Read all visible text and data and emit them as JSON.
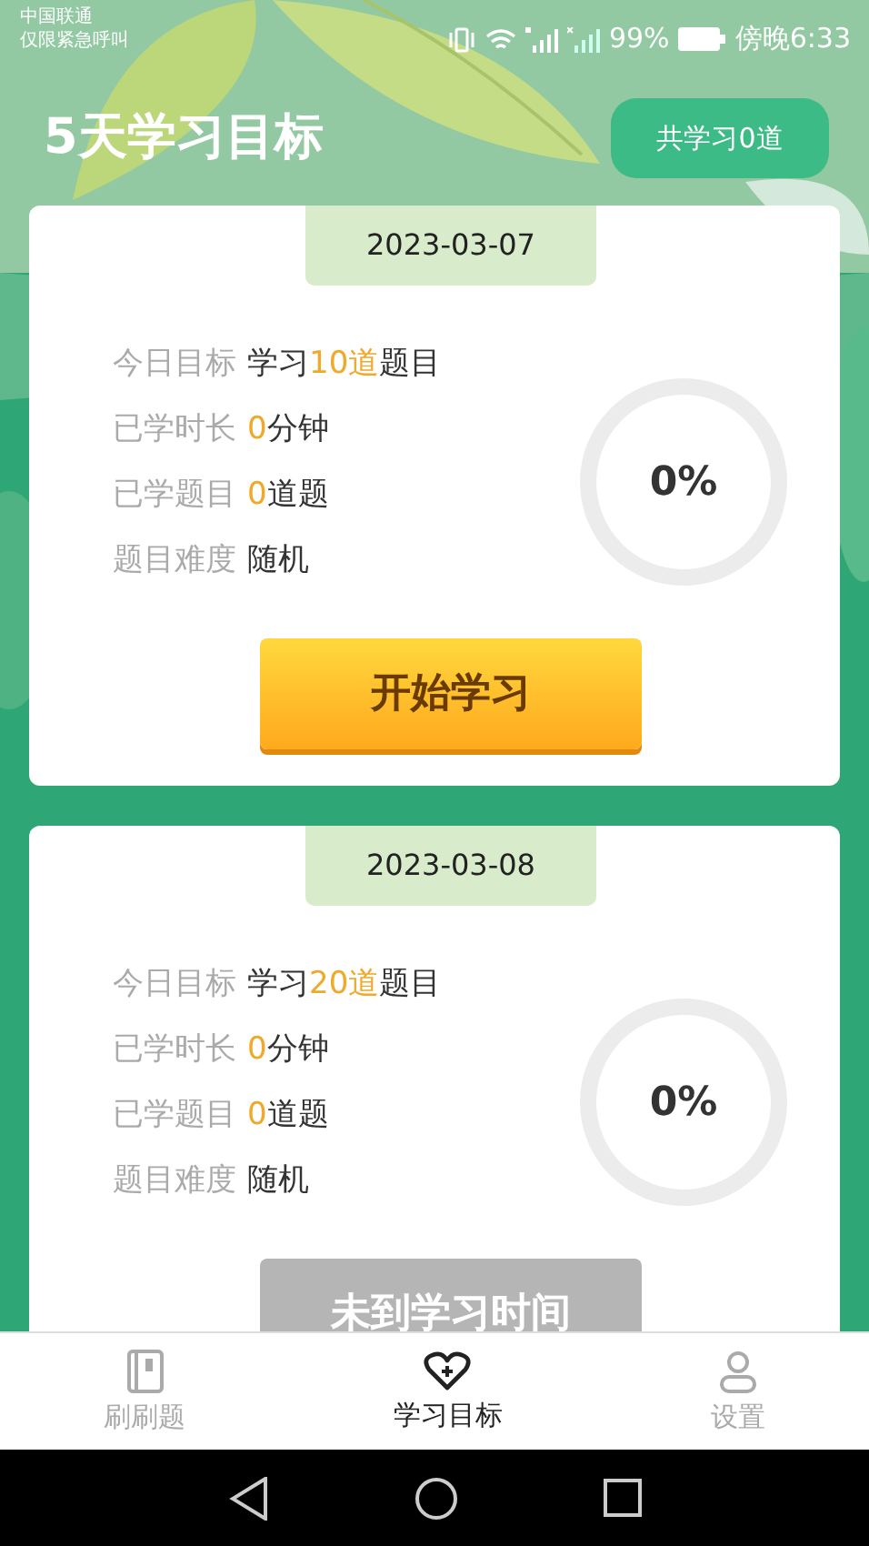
{
  "status_bar": {
    "carrier": [
      "中国联通",
      "仅限紧急呼叫"
    ],
    "battery": "99%",
    "time": "傍晚6:33"
  },
  "header": {
    "title": "5天学习目标",
    "total_button": "共学习0道"
  },
  "plans": [
    {
      "date": "2023-03-07",
      "rows": [
        {
          "label": "今日目标",
          "parts": [
            {
              "text": "学习",
              "highlight": false
            },
            {
              "text": "10道",
              "highlight": true
            },
            {
              "text": "题目",
              "highlight": false
            }
          ]
        },
        {
          "label": "已学时长",
          "parts": [
            {
              "text": "0",
              "highlight": true
            },
            {
              "text": "分钟",
              "highlight": false
            }
          ]
        },
        {
          "label": "已学题目",
          "parts": [
            {
              "text": "0",
              "highlight": true
            },
            {
              "text": "道题",
              "highlight": false
            }
          ]
        },
        {
          "label": "题目难度",
          "parts": [
            {
              "text": "随机",
              "highlight": false
            }
          ]
        }
      ],
      "level": 0,
      "reading": "0%",
      "button": "开始学习",
      "disabled": false
    },
    {
      "date": "2023-03-08",
      "rows": [
        {
          "label": "今日目标",
          "parts": [
            {
              "text": "学习",
              "highlight": false
            },
            {
              "text": "20道",
              "highlight": true
            },
            {
              "text": "题目",
              "highlight": false
            }
          ]
        },
        {
          "label": "已学时长",
          "parts": [
            {
              "text": "0",
              "highlight": true
            },
            {
              "text": "分钟",
              "highlight": false
            }
          ]
        },
        {
          "label": "已学题目",
          "parts": [
            {
              "text": "0",
              "highlight": true
            },
            {
              "text": "道题",
              "highlight": false
            }
          ]
        },
        {
          "label": "题目难度",
          "parts": [
            {
              "text": "随机",
              "highlight": false
            }
          ]
        }
      ],
      "level": 0,
      "reading": "0%",
      "button": "未到学习时间",
      "disabled": true
    }
  ],
  "tabs": [
    {
      "label": "刷刷题",
      "selected": false
    },
    {
      "label": "学习目标",
      "selected": true
    },
    {
      "label": "设置",
      "selected": false
    }
  ]
}
